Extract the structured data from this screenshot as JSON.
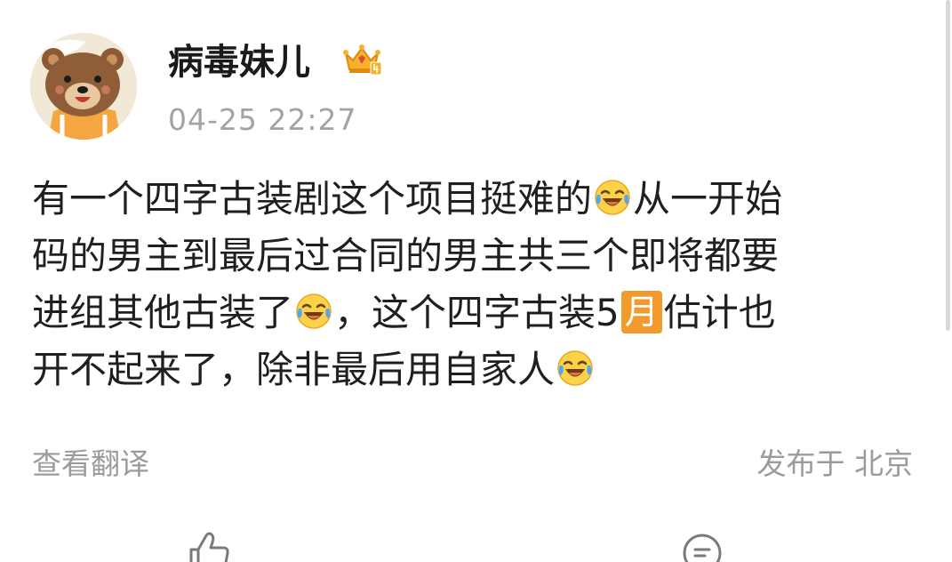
{
  "post": {
    "author": "病毒妹儿",
    "badge_icon": "crown-vip-level-4-icon",
    "timestamp": "04-25 22:27",
    "lines": [
      [
        "有一个四字古装剧这个项目挺难的",
        "从一开始"
      ],
      [
        "码的男主到最后过合同的男主共三个即将都要"
      ],
      [
        "进组其他古装了",
        "，这个四字古装5",
        "月",
        "估计也"
      ],
      [
        "开不起来了，除非最后用自家人"
      ]
    ],
    "emoji_icon": "laughing-crying-face-icon",
    "translate_link": "查看翻译",
    "location": "发布于 北京"
  },
  "actions": {
    "like_icon": "thumbs-up-icon",
    "comment_icon": "comment-icon"
  },
  "colors": {
    "text": "#1f1f1f",
    "muted": "#9b9b9b",
    "badge": "#f29a2e"
  }
}
